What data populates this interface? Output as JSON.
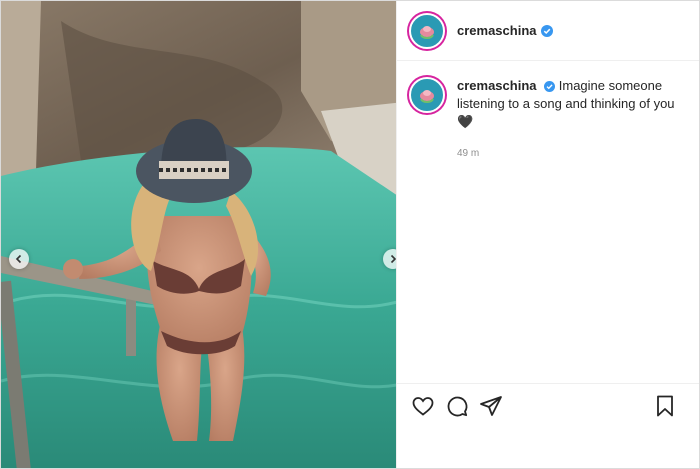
{
  "post": {
    "username": "cremaschina",
    "caption": "Imagine someone listening to a song and thinking of you",
    "emoji": "🖤",
    "timestamp": "49 m"
  },
  "icons": {
    "avatar": "avatar-flower-icon",
    "verified": "verified-badge-icon",
    "like": "heart-icon",
    "comment": "comment-bubble-icon",
    "share": "paper-plane-icon",
    "save": "bookmark-icon",
    "prev": "chevron-left-icon",
    "next": "chevron-right-icon"
  },
  "colors": {
    "verified": "#3897f0",
    "story_ring": "#d6249f",
    "water": "#3fb59f"
  }
}
